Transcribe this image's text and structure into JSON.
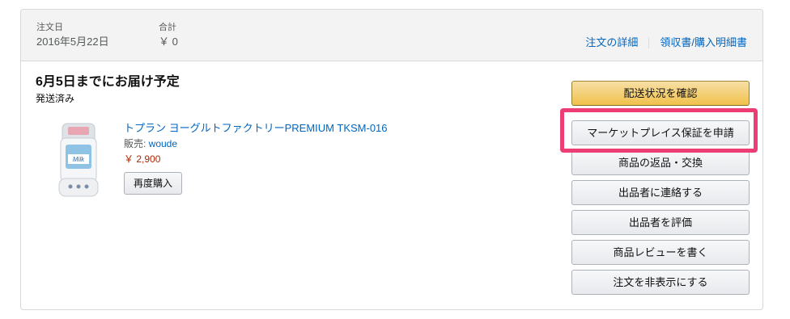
{
  "order": {
    "date_label": "注文日",
    "date_value": "2016年5月22日",
    "total_label": "合計",
    "total_value": "￥ 0",
    "details_link": "注文の詳細",
    "receipt_link": "領収書/購入明細書"
  },
  "shipment": {
    "title": "6月5日までにお届け予定",
    "status": "発送済み"
  },
  "item": {
    "image_icon": "yogurt-maker-product-icon",
    "image_text": "Milk",
    "title": "トプラン ヨーグルトファクトリーPREMIUM TKSM-016",
    "seller_label": "販売: ",
    "seller_name": "woude",
    "price": "￥ 2,900",
    "rebuy_label": "再度購入"
  },
  "actions": {
    "track": "配送状況を確認",
    "guarantee": "マーケットプレイス保証を申請",
    "return": "商品の返品・交換",
    "contact_seller": "出品者に連絡する",
    "rate_seller": "出品者を評価",
    "write_review": "商品レビューを書く",
    "hide_order": "注文を非表示にする"
  },
  "colors": {
    "link": "#0066c0",
    "price": "#b12704",
    "primary_button": "#f0c14b",
    "highlight": "#ec3d74"
  }
}
